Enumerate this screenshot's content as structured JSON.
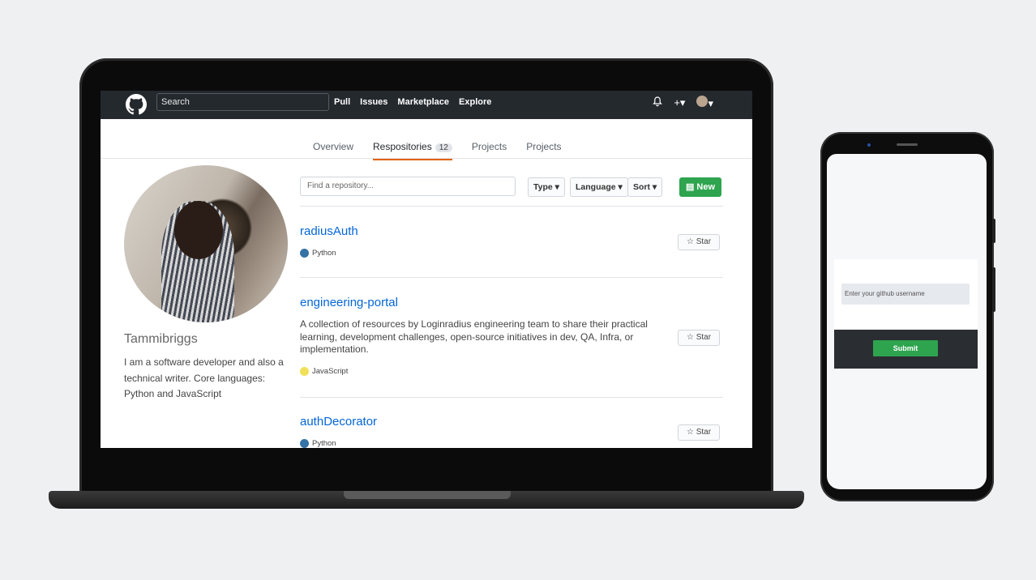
{
  "header": {
    "search_placeholder": "Search",
    "nav": [
      "Pull",
      "Issues",
      "Marketplace",
      "Explore"
    ],
    "icons": [
      "bell-icon",
      "plus-icon",
      "avatar"
    ]
  },
  "tabs": [
    {
      "label": "Overview",
      "active": false
    },
    {
      "label": "Respositories",
      "active": true,
      "count": "12"
    },
    {
      "label": "Projects",
      "active": false
    },
    {
      "label": "Projects",
      "active": false
    }
  ],
  "profile": {
    "name": "Tammibriggs",
    "bio": "I am a software developer and also a technical writer. Core languages: Python and JavaScript"
  },
  "filter": {
    "placeholder": "Find a repository...",
    "type_label": "Type ▾",
    "language_label": "Language ▾",
    "sort_label": "Sort ▾",
    "new_label": "New"
  },
  "repos": [
    {
      "name": "radiusAuth",
      "description": "",
      "language": "Python",
      "lang_color": "#3572A5",
      "star_label": "Star"
    },
    {
      "name": "engineering-portal",
      "description": "A collection of resources by Loginradius engineering team to share their practical learning, development challenges, open-source initiatives in dev, QA, Infra, or implementation.",
      "language": "JavaScript",
      "lang_color": "#f1e05a",
      "star_label": "Star"
    },
    {
      "name": "authDecorator",
      "description": "",
      "language": "Python",
      "lang_color": "#3572A5",
      "star_label": "Star"
    }
  ],
  "phone": {
    "input_placeholder": "Enter your github username",
    "submit_label": "Submit"
  }
}
